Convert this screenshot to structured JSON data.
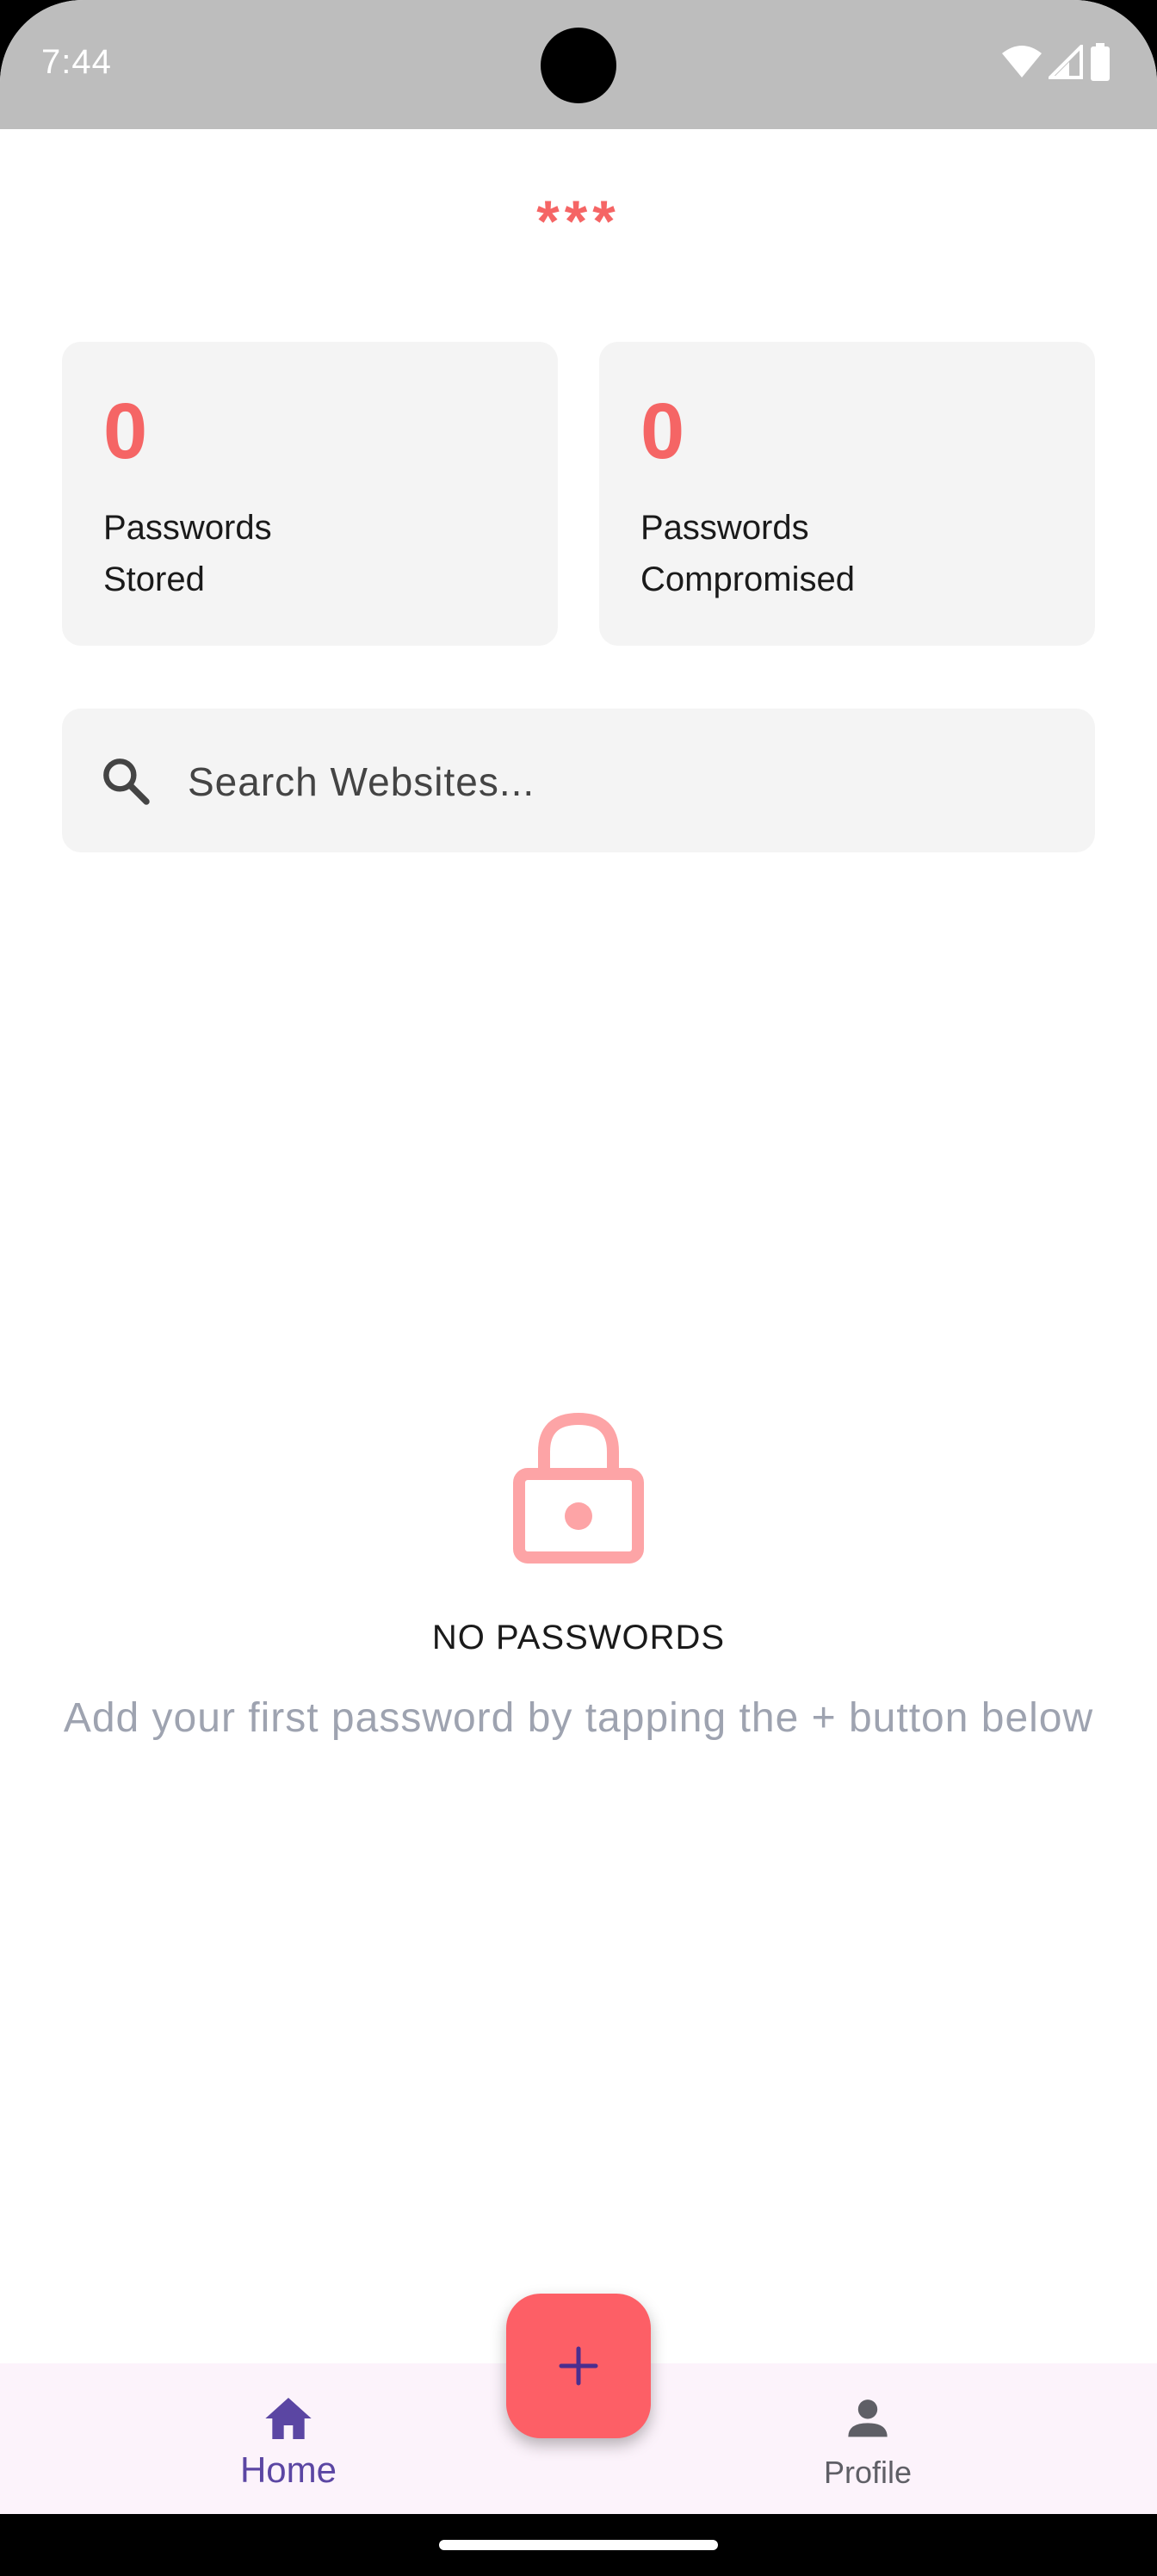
{
  "status_bar": {
    "time": "7:44",
    "icons": [
      "wifi-icon",
      "signal-icon",
      "battery-icon"
    ]
  },
  "app": {
    "title": "***"
  },
  "stats": [
    {
      "value": "0",
      "label_line1": "Passwords",
      "label_line2": "Stored"
    },
    {
      "value": "0",
      "label_line1": "Passwords",
      "label_line2": "Compromised"
    }
  ],
  "search": {
    "placeholder": "Search Websites...",
    "value": ""
  },
  "empty_state": {
    "icon": "lock-icon",
    "title": "NO PASSWORDS",
    "subtitle": "Add your first password by tapping the + button below"
  },
  "fab": {
    "icon": "plus-icon"
  },
  "bottom_nav": {
    "items": [
      {
        "label": "Home",
        "icon": "home-icon",
        "active": true
      },
      {
        "label": "Profile",
        "icon": "person-icon",
        "active": false
      }
    ]
  },
  "colors": {
    "accent": "#f56565",
    "fab": "#fd5f66",
    "nav_active": "#5b46a3",
    "nav_bg": "#fcf3fb",
    "card_bg": "#f4f4f4",
    "status_bar_bg": "#bdbdbd"
  }
}
